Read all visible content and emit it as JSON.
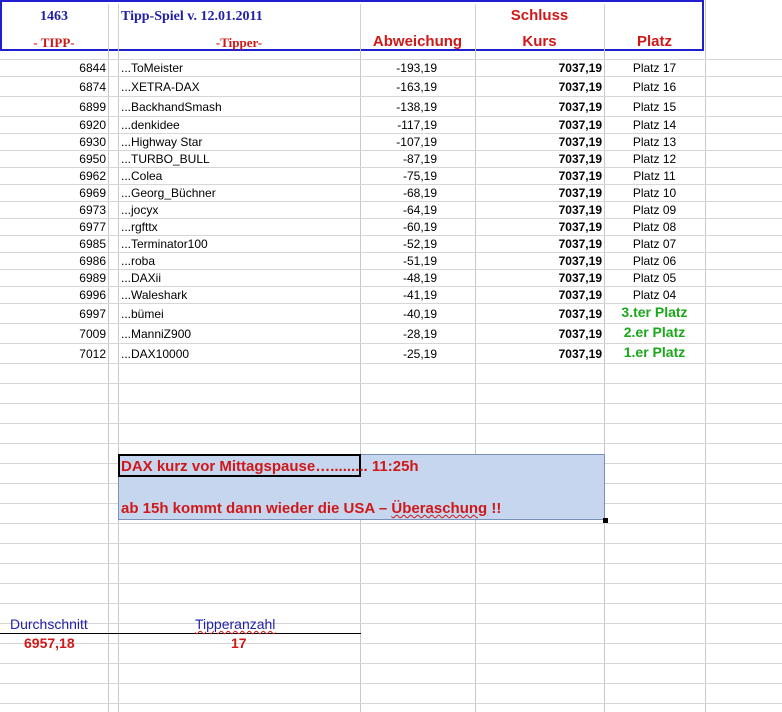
{
  "header": {
    "number": "1463",
    "title": "Tipp-Spiel v. 12.01.2011",
    "schluss": "Schluss",
    "tipp_label": "- TIPP-",
    "tipper_label": "-Tipper-",
    "abweichung_label": "Abweichung",
    "kurs_label": "Kurs",
    "platz_label": "Platz"
  },
  "rows": [
    {
      "tipp": "6844",
      "tipper": "...ToMeister",
      "abweichung": "-193,19",
      "kurs": "7037,19",
      "platz": "Platz 17"
    },
    {
      "tipp": "6874",
      "tipper": "...XETRA-DAX",
      "abweichung": "-163,19",
      "kurs": "7037,19",
      "platz": "Platz 16"
    },
    {
      "tipp": "6899",
      "tipper": "...BackhandSmash",
      "abweichung": "-138,19",
      "kurs": "7037,19",
      "platz": "Platz 15"
    },
    {
      "tipp": "6920",
      "tipper": "...denkidee",
      "abweichung": "-117,19",
      "kurs": "7037,19",
      "platz": "Platz 14"
    },
    {
      "tipp": "6930",
      "tipper": "...Highway Star",
      "abweichung": "-107,19",
      "kurs": "7037,19",
      "platz": "Platz 13"
    },
    {
      "tipp": "6950",
      "tipper": "...TURBO_BULL",
      "abweichung": "-87,19",
      "kurs": "7037,19",
      "platz": "Platz 12"
    },
    {
      "tipp": "6962",
      "tipper": "...Colea",
      "abweichung": "-75,19",
      "kurs": "7037,19",
      "platz": "Platz 11"
    },
    {
      "tipp": "6969",
      "tipper": "...Georg_Büchner",
      "abweichung": "-68,19",
      "kurs": "7037,19",
      "platz": "Platz 10"
    },
    {
      "tipp": "6973",
      "tipper": "...jocyx",
      "abweichung": "-64,19",
      "kurs": "7037,19",
      "platz": "Platz 09"
    },
    {
      "tipp": "6977",
      "tipper": "...rgfttx",
      "abweichung": "-60,19",
      "kurs": "7037,19",
      "platz": "Platz 08"
    },
    {
      "tipp": "6985",
      "tipper": "...Terminator100",
      "abweichung": "-52,19",
      "kurs": "7037,19",
      "platz": "Platz 07"
    },
    {
      "tipp": "6986",
      "tipper": "...roba",
      "abweichung": "-51,19",
      "kurs": "7037,19",
      "platz": "Platz 06"
    },
    {
      "tipp": "6989",
      "tipper": "...DAXii",
      "abweichung": "-48,19",
      "kurs": "7037,19",
      "platz": "Platz 05"
    },
    {
      "tipp": "6996",
      "tipper": "...Waleshark",
      "abweichung": "-41,19",
      "kurs": "7037,19",
      "platz": "Platz 04"
    },
    {
      "tipp": "6997",
      "tipper": "...bümei",
      "abweichung": "-40,19",
      "kurs": "7037,19",
      "platz": "3.ter Platz"
    },
    {
      "tipp": "7009",
      "tipper": "...ManniZ900",
      "abweichung": "-28,19",
      "kurs": "7037,19",
      "platz": "2.er Platz"
    },
    {
      "tipp": "7012",
      "tipper": "...DAX10000",
      "abweichung": "-25,19",
      "kurs": "7037,19",
      "platz": "1.er Platz"
    }
  ],
  "note": {
    "line1": "DAX kurz vor Mittagspause…......... 11:25h",
    "line2_pre": "ab 15h kommt dann wieder die USA – ",
    "line2_word": "Überaschung",
    "line2_post": " !!"
  },
  "footer": {
    "durchschnitt_label": "Durchschnitt",
    "durchschnitt_value": "6957,18",
    "tipperanzahl_label": "Tipperanzahl",
    "tipperanzahl_value": "17"
  }
}
